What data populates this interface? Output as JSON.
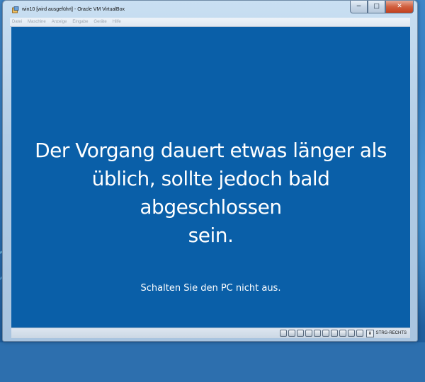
{
  "window": {
    "title": "win10 [wird ausgeführt] - Oracle VM VirtualBox",
    "buttons": {
      "minimize": "−",
      "maximize": "□",
      "close": "✕"
    }
  },
  "menubar": {
    "items": [
      {
        "label": "Datei"
      },
      {
        "label": "Maschine"
      },
      {
        "label": "Anzeige"
      },
      {
        "label": "Eingabe"
      },
      {
        "label": "Geräte"
      },
      {
        "label": "Hilfe"
      }
    ]
  },
  "vm": {
    "message_lines": [
      "Der Vorgang dauert etwas länger als",
      "üblich, sollte jedoch bald abgeschlossen",
      "sein."
    ],
    "sub_message": "Schalten Sie den PC nicht aus.",
    "background_color": "#0a5fa8"
  },
  "statusbar": {
    "icons": [
      "hard-disk-icon",
      "optical-drive-icon",
      "audio-icon",
      "network-icon",
      "usb-icon",
      "shared-folder-icon",
      "display-icon",
      "video-capture-icon",
      "virtualization-icon",
      "mouse-integration-icon",
      "keyboard-capture-icon"
    ],
    "host_key": "STRG-RECHTS"
  }
}
